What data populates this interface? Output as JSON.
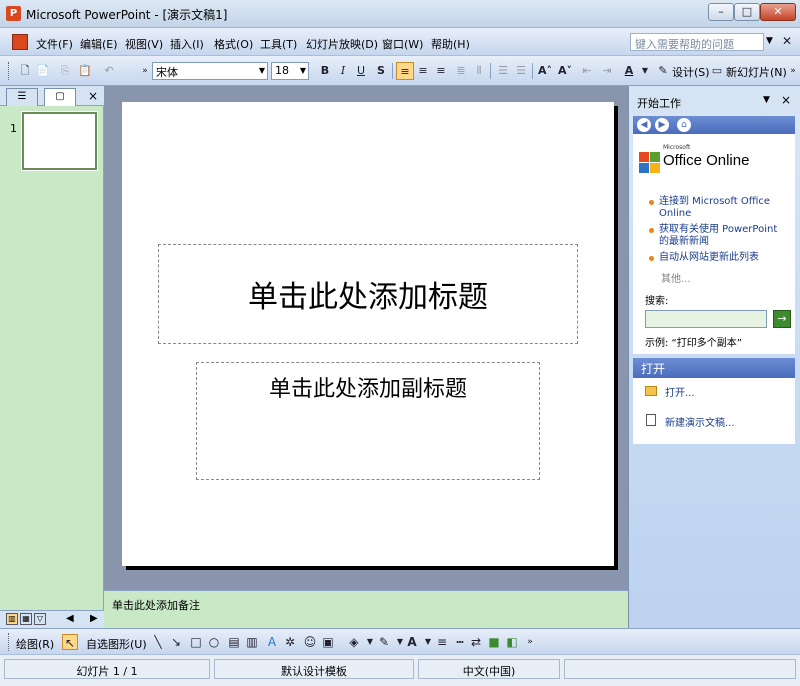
{
  "window": {
    "title": "Microsoft PowerPoint - [演示文稿1]",
    "min_label": "–",
    "max_label": "□",
    "close_label": "✕"
  },
  "menu": {
    "items": [
      "文件(F)",
      "编辑(E)",
      "视图(V)",
      "插入(I)",
      "格式(O)",
      "工具(T)",
      "幻灯片放映(D)",
      "窗口(W)",
      "帮助(H)"
    ],
    "help_placeholder": "键入需要帮助的问题",
    "close_label": "✕"
  },
  "toolbar": {
    "font_name": "宋体",
    "font_size": "18",
    "bold_label": "B",
    "italic_label": "I",
    "underline_label": "U",
    "shadow_label": "S",
    "design_label": "设计(S)",
    "new_slide_label": "新幻灯片(N)"
  },
  "left_pane": {
    "close_label": "×",
    "slide_number": "1"
  },
  "slide": {
    "title_placeholder": "单击此处添加标题",
    "subtitle_placeholder": "单击此处添加副标题"
  },
  "notes": {
    "placeholder": "单击此处添加备注"
  },
  "task_pane": {
    "title": "开始工作",
    "close_label": "×",
    "logo_small": "Microsoft",
    "logo_text": "Office Online",
    "links": [
      "连接到 Microsoft Office Online",
      "获取有关使用 PowerPoint 的最新新闻",
      "自动从网站更新此列表"
    ],
    "more": "其他...",
    "search_label": "搜索:",
    "search_value": "",
    "example": "示例:  “打印多个副本”",
    "open_section": "打开",
    "open_link": "打开...",
    "new_link": "新建演示文稿..."
  },
  "draw": {
    "draw_label": "绘图(R)",
    "autoshapes_label": "自选图形(U)"
  },
  "status": {
    "slide": "幻灯片 1 / 1",
    "design": "默认设计模板",
    "language": "中文(中国)"
  },
  "colors": {
    "accent": "#4a6cbc",
    "pane_green": "#c8e8c6",
    "editor_bg": "#8995ac"
  }
}
